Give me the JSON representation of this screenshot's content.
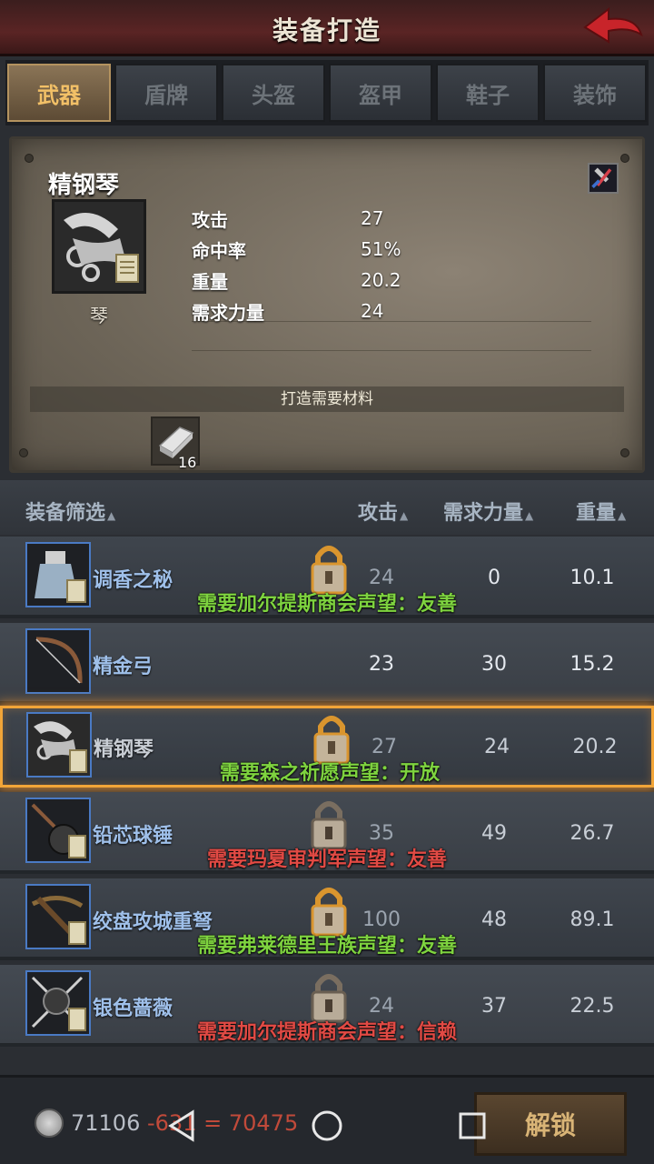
{
  "header": {
    "title": "装备打造"
  },
  "tabs": [
    {
      "label": "武器",
      "active": true
    },
    {
      "label": "盾牌",
      "active": false
    },
    {
      "label": "头盔",
      "active": false
    },
    {
      "label": "盔甲",
      "active": false
    },
    {
      "label": "鞋子",
      "active": false
    },
    {
      "label": "装饰",
      "active": false
    }
  ],
  "detail": {
    "name": "精钢琴",
    "type": "琴",
    "stats": [
      {
        "label": "攻击",
        "value": "27"
      },
      {
        "label": "命中率",
        "value": "51%"
      },
      {
        "label": "重量",
        "value": "20.2"
      },
      {
        "label": "需求力量",
        "value": "24"
      }
    ],
    "materials_label": "打造需要材料",
    "material_count": "16"
  },
  "filter": {
    "name_label": "装备筛选",
    "atk_label": "攻击",
    "req_label": "需求力量",
    "weight_label": "重量"
  },
  "items": [
    {
      "name": "调香之秘",
      "atk": "24",
      "req": "0",
      "weight": "10.1",
      "locked": true,
      "msg": "需要加尔提斯商会声望：友善",
      "msg_color": "#7ed33f"
    },
    {
      "name": "精金弓",
      "atk": "23",
      "req": "30",
      "weight": "15.2",
      "locked": false,
      "msg": "",
      "msg_color": ""
    },
    {
      "name": "精钢琴",
      "atk": "27",
      "req": "24",
      "weight": "20.2",
      "locked": true,
      "msg": "需要森之祈愿声望：开放",
      "msg_color": "#7ed33f"
    },
    {
      "name": "铅芯球锤",
      "atk": "35",
      "req": "49",
      "weight": "26.7",
      "locked": true,
      "msg": "需要玛夏审判军声望：友善",
      "msg_color": "#e14a44"
    },
    {
      "name": "绞盘攻城重弩",
      "atk": "100",
      "req": "48",
      "weight": "89.1",
      "locked": true,
      "msg": "需要弗莱德里王族声望：友善",
      "msg_color": "#7ed33f"
    },
    {
      "name": "银色蔷薇",
      "atk": "24",
      "req": "37",
      "weight": "22.5",
      "locked": true,
      "msg": "需要加尔提斯商会声望：信赖",
      "msg_color": "#e14a44"
    }
  ],
  "footer": {
    "money": "71106",
    "cost": "-631",
    "equals": "=",
    "result": "70475",
    "unlock_label": "解锁"
  },
  "colors": {
    "accent_gold": "#f2c067",
    "selected_glow": "#f2a538",
    "reputation_ok": "#7ed33f",
    "reputation_bad": "#e14a44"
  },
  "icons": [
    "back-arrow-icon",
    "disassemble-icon",
    "padlock-icon",
    "coin-icon",
    "scroll-icon"
  ]
}
